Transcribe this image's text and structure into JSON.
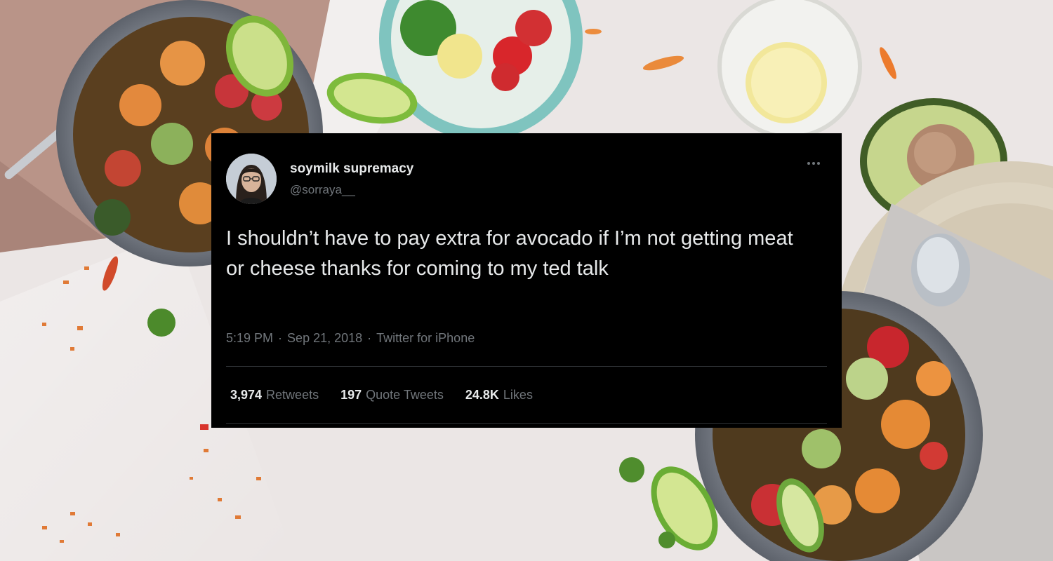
{
  "tweet": {
    "display_name": "soymilk supremacy",
    "handle": "@sorraya__",
    "text": "I shouldn’t have to pay extra for avocado if I’m not getting meat or cheese thanks for coming to my ted talk",
    "time": "5:19 PM",
    "separator": "·",
    "date": "Sep 21, 2018",
    "source": "Twitter for iPhone",
    "more_icon": "more-horizontal-icon",
    "stats": {
      "retweets_count": "3,974",
      "retweets_label": "Retweets",
      "quotes_count": "197",
      "quotes_label": "Quote Tweets",
      "likes_count": "24.8K",
      "likes_label": "Likes"
    }
  },
  "colors": {
    "card_background": "#000000",
    "primary_text": "#e7e9ea",
    "secondary_text": "#71767b",
    "divider": "#2f3336",
    "page_background": "#ebe6e5"
  }
}
